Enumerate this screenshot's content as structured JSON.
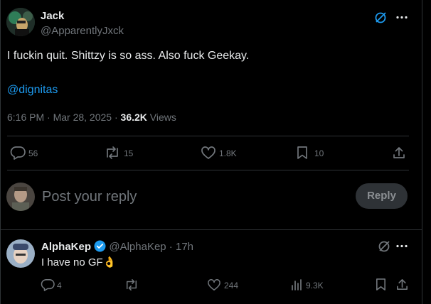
{
  "tweet": {
    "author_name": "Jack",
    "author_handle": "@ApparentlyJxck",
    "body": "I fuckin quit. Shittzy is so ass. Also fuck Geekay.",
    "mention": "@dignitas",
    "time": "6:16 PM · Mar 28, 2025 · ",
    "views_count": "36.2K",
    "views_label": " Views",
    "actions": {
      "replies": "56",
      "reposts": "15",
      "likes": "1.8K",
      "bookmarks": "10"
    }
  },
  "composer": {
    "placeholder": "Post your reply",
    "reply_button": "Reply"
  },
  "reply": {
    "author_name": "AlphaKep",
    "author_handle": "@AlphaKep",
    "time": " · 17h",
    "body": "I have no GF",
    "body_emoji": "👌",
    "actions": {
      "replies": "4",
      "likes": "244",
      "views": "9.3K"
    }
  },
  "colors": {
    "accent": "#1d9bf0",
    "muted": "#71767b",
    "divider": "#2f3336",
    "verified": "#1d9bf0"
  },
  "icons": [
    "grok-icon",
    "more-icon",
    "reply-icon",
    "repost-icon",
    "like-icon",
    "bookmark-icon",
    "share-icon",
    "views-icon",
    "verified-icon"
  ]
}
